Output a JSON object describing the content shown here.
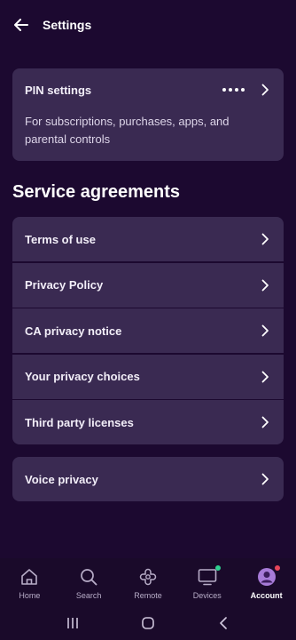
{
  "header": {
    "title": "Settings"
  },
  "pin": {
    "title": "PIN settings",
    "description": "For subscriptions, purchases, apps, and parental controls"
  },
  "section_heading": "Service agreements",
  "agreements": [
    {
      "label": "Terms of use"
    },
    {
      "label": "Privacy Policy"
    },
    {
      "label": "CA privacy notice"
    },
    {
      "label": "Your privacy choices"
    },
    {
      "label": "Third party licenses"
    }
  ],
  "voice": {
    "label": "Voice privacy"
  },
  "bottom_nav": [
    {
      "label": "Home",
      "icon": "home-icon",
      "active": false
    },
    {
      "label": "Search",
      "icon": "search-icon",
      "active": false
    },
    {
      "label": "Remote",
      "icon": "remote-icon",
      "active": false
    },
    {
      "label": "Devices",
      "icon": "tv-icon",
      "active": false,
      "badge_color": "#2ecf8f"
    },
    {
      "label": "Account",
      "icon": "avatar-icon",
      "active": true,
      "badge_color": "#e8455a"
    }
  ],
  "colors": {
    "background": "#1c0930",
    "card": "#3a2a52",
    "accent_avatar": "#a77bd8"
  }
}
